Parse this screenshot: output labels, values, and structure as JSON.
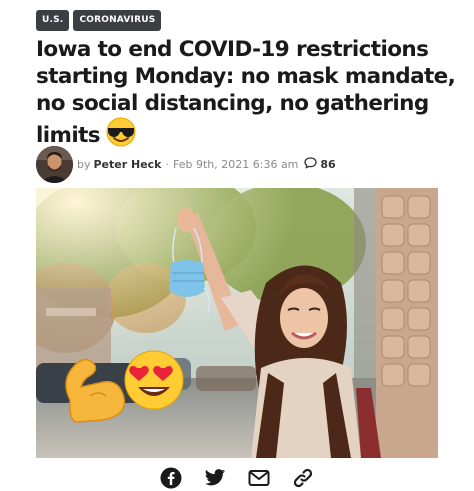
{
  "tags": [
    {
      "label": "U.S."
    },
    {
      "label": "CORONAVIRUS"
    }
  ],
  "headline": {
    "text": "Iowa to end COVID-19 restrictions starting Monday: no mask mandate, no social distancing, no gathering limits",
    "emoji_icon": "sunglasses-face-icon"
  },
  "byline": {
    "prefix": "by",
    "author": "Peter Heck",
    "separator": "·",
    "date": "Feb 9th, 2021 6:36 am",
    "comment_icon": "comment-bubble-icon",
    "comment_count": "86"
  },
  "hero_image": {
    "description_icons": [
      "flexed-biceps-icon",
      "heart-eyes-face-icon",
      "face-mask-icon"
    ]
  },
  "share": {
    "icons": [
      "facebook-icon",
      "twitter-icon",
      "email-icon",
      "link-icon"
    ]
  },
  "colors": {
    "tag_bg": "#3b3f44",
    "text": "#1a1a1a",
    "meta": "#8a8a8a"
  }
}
